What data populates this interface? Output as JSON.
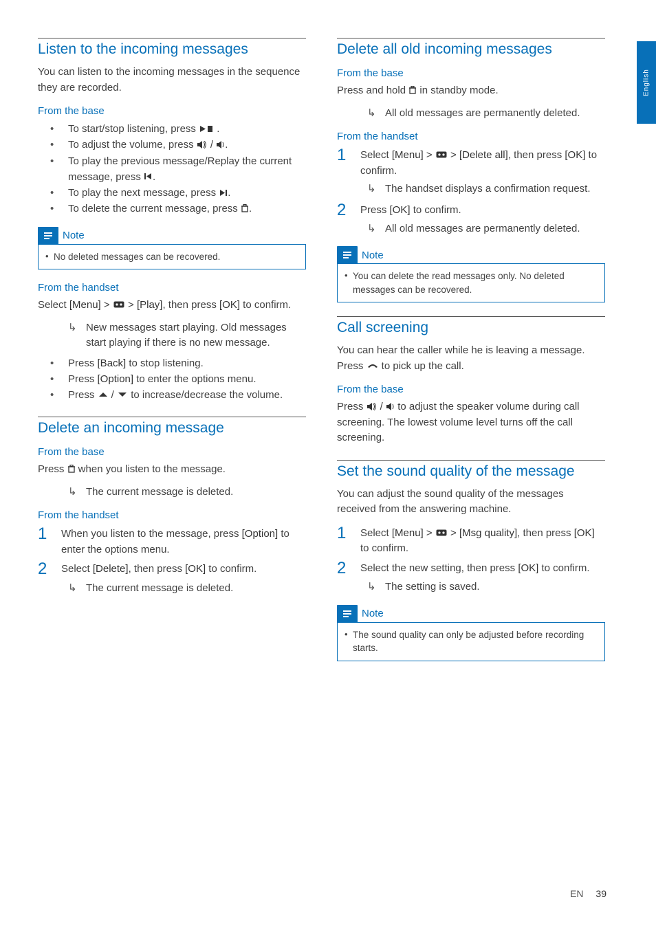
{
  "lang_tab": "English",
  "footer": {
    "lang": "EN",
    "page": "39"
  },
  "col1": {
    "s1": {
      "title": "Listen to the incoming messages",
      "intro": "You can listen to the incoming messages in the sequence they are recorded.",
      "h_base": "From the base",
      "b1a": "To start/stop listening, press ",
      "b1b": " .",
      "b2a": "To adjust the volume, press ",
      "b2b": " / ",
      "b2c": ".",
      "b3a": "To play the previous message/Replay the current message, press ",
      "b3b": ".",
      "b4a": "To play the next message, press ",
      "b4b": ".",
      "b5a": "To delete the current message, press ",
      "b5b": ".",
      "note1": "No deleted messages can be recovered.",
      "h_handset": "From the handset",
      "hs_p_a": "Select ",
      "hs_p_menu": "[Menu]",
      "hs_p_b": " > ",
      "hs_p_c": " > ",
      "hs_p_play": "[Play]",
      "hs_p_d": ", then press ",
      "hs_p_ok": "[OK]",
      "hs_p_e": " to confirm.",
      "hs_res": "New messages start playing. Old messages start playing if there is no new message.",
      "hs_b1a": "Press ",
      "hs_b1_back": "[Back]",
      "hs_b1b": " to stop listening.",
      "hs_b2a": "Press ",
      "hs_b2_opt": "[Option]",
      "hs_b2b": " to enter the options menu.",
      "hs_b3a": "Press ",
      "hs_b3b": " / ",
      "hs_b3c": " to increase/decrease the volume."
    },
    "s2": {
      "title": "Delete an incoming message",
      "h_base": "From the base",
      "base_p_a": "Press ",
      "base_p_b": " when you listen to the message.",
      "base_res": "The current message is deleted.",
      "h_handset": "From the handset",
      "st1a": "When you listen to the message, press ",
      "st1_opt": "[Option]",
      "st1b": " to enter the options menu.",
      "st2a": "Select ",
      "st2_del": "[Delete]",
      "st2b": ", then press ",
      "st2_ok": "[OK]",
      "st2c": " to confirm.",
      "st2_res": "The current message is deleted."
    }
  },
  "col2": {
    "s1": {
      "title": "Delete all old incoming messages",
      "h_base": "From the base",
      "base_p_a": "Press and hold ",
      "base_p_b": " in standby mode.",
      "base_res": "All old messages are permanently deleted.",
      "h_handset": "From the handset",
      "st1a": "Select ",
      "st1_menu": "[Menu]",
      "st1b": " > ",
      "st1c": " > ",
      "st1_del": "[Delete all]",
      "st1d": ", then press ",
      "st1_ok": "[OK]",
      "st1e": " to confirm.",
      "st1_res": "The handset displays a confirmation request.",
      "st2a": "Press ",
      "st2_ok": "[OK]",
      "st2b": " to confirm.",
      "st2_res": "All old messages are permanently deleted.",
      "note": "You can delete the read messages only. No deleted messages can be recovered."
    },
    "s2": {
      "title": "Call screening",
      "p_a": "You can hear the caller while he is leaving a message. Press ",
      "p_b": " to pick up the call.",
      "h_base": "From the base",
      "base_a": "Press ",
      "base_b": " / ",
      "base_c": " to adjust the speaker volume during call screening. The lowest volume level turns off the call screening."
    },
    "s3": {
      "title": "Set the sound quality of the message",
      "intro": "You can adjust the sound quality of the messages received from the answering machine.",
      "st1a": "Select ",
      "st1_menu": "[Menu]",
      "st1b": " > ",
      "st1c": " > ",
      "st1_mq": "[Msg quality]",
      "st1d": ", then press ",
      "st1_ok": "[OK]",
      "st1e": " to confirm.",
      "st2a": "Select the new setting, then press ",
      "st2_ok": "[OK]",
      "st2b": " to confirm.",
      "st2_res": "The setting is saved.",
      "note": "The sound quality can only be adjusted before recording starts."
    }
  },
  "note_label": "Note"
}
